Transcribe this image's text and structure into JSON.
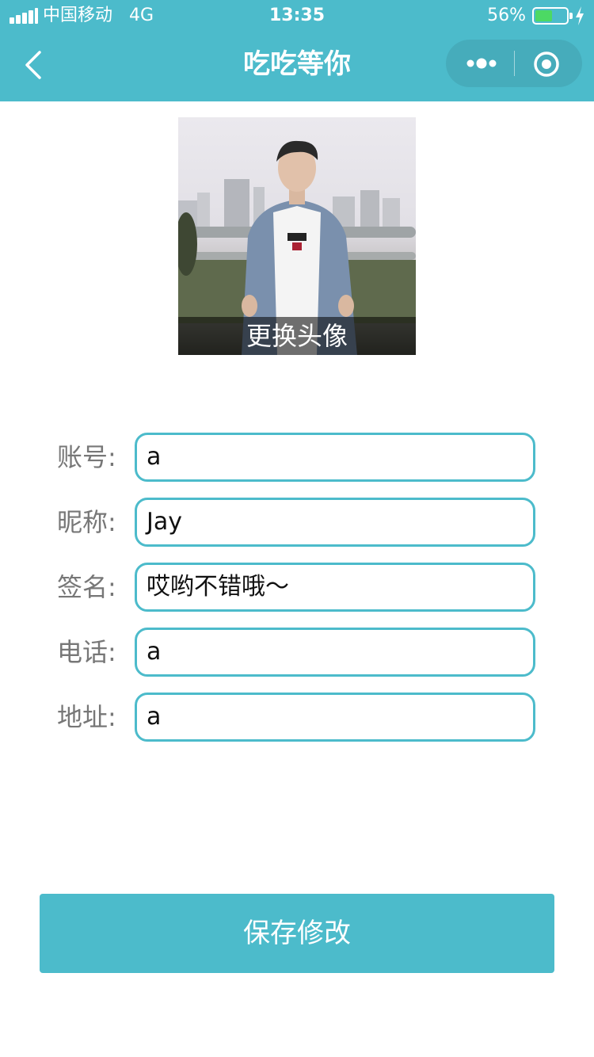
{
  "status_bar": {
    "carrier": "中国移动",
    "network": "4G",
    "time": "13:35",
    "battery_percent": "56%",
    "battery_level": 0.56,
    "battery_color": "#4cd964"
  },
  "nav": {
    "title": "吃吃等你",
    "back_icon": "chevron-left-icon",
    "more_icon": "more-dots-icon",
    "close_icon": "target-icon"
  },
  "avatar": {
    "change_label": "更换头像"
  },
  "form": {
    "fields": [
      {
        "label": "账号:",
        "value": "a"
      },
      {
        "label": "昵称:",
        "value": "Jay"
      },
      {
        "label": "签名:",
        "value": "哎哟不错哦～"
      },
      {
        "label": "电话:",
        "value": "a"
      },
      {
        "label": "地址:",
        "value": "a"
      }
    ]
  },
  "save_button": {
    "label": "保存修改"
  },
  "colors": {
    "accent": "#4cbbcb",
    "label": "#777777"
  }
}
